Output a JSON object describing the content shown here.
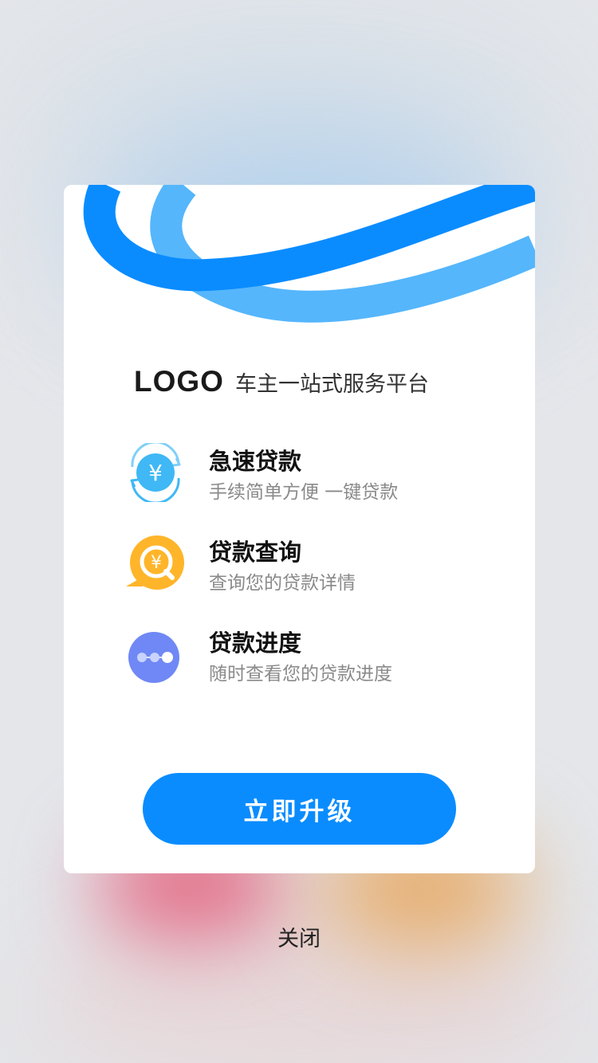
{
  "header": {
    "logo_text": "LOGO",
    "tagline": "车主一站式服务平台"
  },
  "features": [
    {
      "title": "急速贷款",
      "desc": "手续简单方便 一键贷款",
      "icon": "yuan-exchange-icon",
      "color": "#3fb8f5"
    },
    {
      "title": "贷款查询",
      "desc": "查询您的贷款详情",
      "icon": "yuan-search-icon",
      "color": "#ffb52a"
    },
    {
      "title": "贷款进度",
      "desc": "随时查看您的贷款进度",
      "icon": "progress-dots-icon",
      "color": "#7088f5"
    }
  ],
  "actions": {
    "upgrade_label": "立即升级",
    "close_label": "关闭"
  },
  "colors": {
    "primary": "#0a8cff",
    "wave_dark": "#0a8cff",
    "wave_light": "#55b6fc"
  }
}
